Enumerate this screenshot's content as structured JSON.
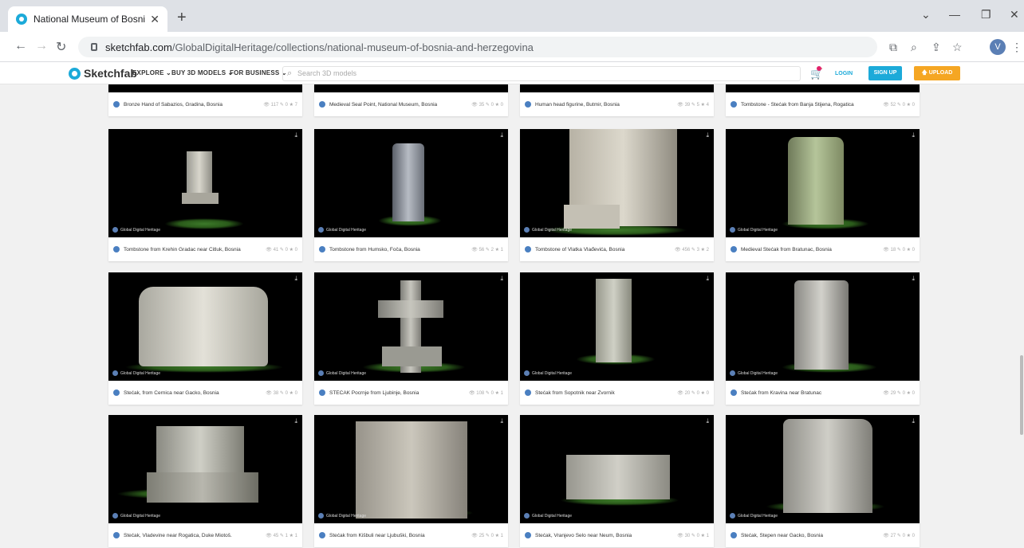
{
  "browser": {
    "tab_title": "National Museum of Bosnia and",
    "tab_close": "✕",
    "new_tab": "+",
    "url_host": "sketchfab.com",
    "url_path": "/GlobalDigitalHeritage/collections/national-museum-of-bosnia-and-herzegovina",
    "profile_initial": "V",
    "controls": {
      "minimize": "—",
      "restore": "❐",
      "close": "✕"
    }
  },
  "sketchfab": {
    "logo": "Sketchfab",
    "nav": [
      "EXPLORE ⌄",
      "BUY 3D MODELS ⌄",
      "FOR BUSINESS ⌄"
    ],
    "search_placeholder": "Search 3D models",
    "login": "LOGIN",
    "signup": "SIGN UP",
    "upload": "🡅 UPLOAD",
    "accent": "#1caad9",
    "upload_color": "#f5a623"
  },
  "top_row": [
    {
      "title": "Bronze Hand of Sabazios, Gradina, Bosnia",
      "stats": "👁 117 ✎ 0 ★ 7"
    },
    {
      "title": "Medieval Seal Point, National Museum, Bosnia",
      "stats": "👁 35 ✎ 0 ★ 0"
    },
    {
      "title": "Human head figurine, Butmir, Bosnia",
      "stats": "👁 39 ✎ 5 ★ 4"
    },
    {
      "title": "Tombstone - Stećak from Banja Stijena, Rogatica",
      "stats": "👁 52 ✎ 0 ★ 0"
    }
  ],
  "author_label": "Global Digital Heritage",
  "cards": [
    {
      "title": "Tombstone from Krehin Gradac near Čitluk, Bosnia",
      "stats": "👁 41 ✎ 0 ★ 0"
    },
    {
      "title": "Tombstone from Humsko, Foča, Bosnia",
      "stats": "👁 56 ✎ 2 ★ 1"
    },
    {
      "title": "Tombstone of Vlatka Vlađevića, Bosnia",
      "stats": "👁 456 ✎ 3 ★ 2"
    },
    {
      "title": "Medieval Stećak from Bratunac, Bosnia",
      "stats": "👁 18 ✎ 0 ★ 0"
    },
    {
      "title": "Stećak, from Cernica near Gacko, Bosnia",
      "stats": "👁 38 ✎ 0 ★ 0"
    },
    {
      "title": "STEĆAK Pocrnje from Ljubinje, Bosnia",
      "stats": "👁 108 ✎ 0 ★ 1"
    },
    {
      "title": "Stećak from Sopotnik near Zvornik",
      "stats": "👁 20 ✎ 0 ★ 0"
    },
    {
      "title": "Stećak from Kravina near Bratunac",
      "stats": "👁 29 ✎ 0 ★ 0"
    },
    {
      "title": "Stećak, Vladevine near Rogatica, Duke Miotoš.",
      "stats": "👁 45 ✎ 1 ★ 1"
    },
    {
      "title": "Stećak from Kišbuli near Ljubuški, Bosnia",
      "stats": "👁 25 ✎ 0 ★ 1"
    },
    {
      "title": "Stećak, Vranjevo Selo near Neum, Bosnia",
      "stats": "👁 30 ✎ 0 ★ 1"
    },
    {
      "title": "Stećak, Stepen near Gacko, Bosnia",
      "stats": "👁 27 ✎ 0 ★ 0"
    }
  ],
  "icons": {
    "download": "download-icon",
    "search": "search-icon",
    "cart": "cart-icon"
  }
}
